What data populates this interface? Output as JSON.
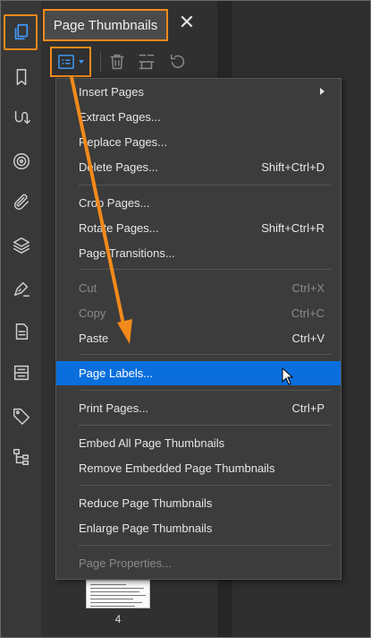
{
  "panel": {
    "title": "Page Thumbnails",
    "close": "✕",
    "page_number": "4"
  },
  "colors": {
    "accent": "#3f9bff",
    "highlight_box": "#f28a1a",
    "menu_selected": "#0a6fdc"
  },
  "rail_icons": [
    "page-thumbnails-icon",
    "bookmark-icon",
    "signature-path-icon",
    "target-icon",
    "paperclip-icon",
    "layers-icon",
    "pen-sign-icon",
    "document-icon",
    "compare-icon",
    "tag-icon",
    "tree-structure-icon"
  ],
  "menu": {
    "items": [
      {
        "label": "Insert Pages",
        "shortcut": "",
        "submenu": true,
        "disabled": false
      },
      {
        "label": "Extract Pages...",
        "shortcut": "",
        "disabled": false
      },
      {
        "label": "Replace Pages...",
        "shortcut": "",
        "disabled": false
      },
      {
        "label": "Delete Pages...",
        "shortcut": "Shift+Ctrl+D",
        "disabled": false
      },
      {
        "label": "Crop Pages...",
        "shortcut": "",
        "disabled": false
      },
      {
        "label": "Rotate Pages...",
        "shortcut": "Shift+Ctrl+R",
        "disabled": false
      },
      {
        "label": "Page Transitions...",
        "shortcut": "",
        "disabled": false
      },
      {
        "label": "Cut",
        "shortcut": "Ctrl+X",
        "disabled": true
      },
      {
        "label": "Copy",
        "shortcut": "Ctrl+C",
        "disabled": true
      },
      {
        "label": "Paste",
        "shortcut": "Ctrl+V",
        "disabled": false
      },
      {
        "label": "Page Labels...",
        "shortcut": "",
        "disabled": false,
        "selected": true
      },
      {
        "label": "Print Pages...",
        "shortcut": "Ctrl+P",
        "disabled": false
      },
      {
        "label": "Embed All Page Thumbnails",
        "shortcut": "",
        "disabled": false
      },
      {
        "label": "Remove Embedded Page Thumbnails",
        "shortcut": "",
        "disabled": false
      },
      {
        "label": "Reduce Page Thumbnails",
        "shortcut": "",
        "disabled": false
      },
      {
        "label": "Enlarge Page Thumbnails",
        "shortcut": "",
        "disabled": false
      },
      {
        "label": "Page Properties...",
        "shortcut": "",
        "disabled": true
      }
    ]
  }
}
